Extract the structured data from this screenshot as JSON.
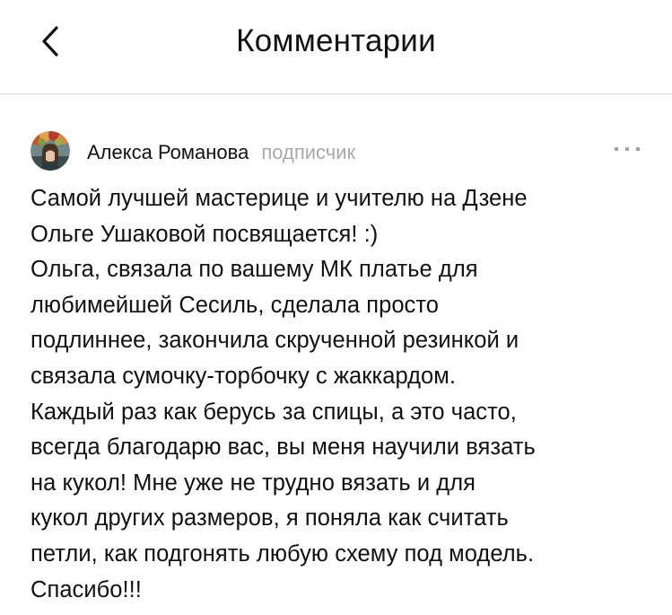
{
  "header": {
    "title": "Комментарии",
    "back_icon": "chevron-left-icon"
  },
  "comment": {
    "author": "Алекса Романова",
    "badge": "подписчик",
    "avatar_icon": "user-avatar",
    "more_icon": "more-dots-icon",
    "text": "Самой лучшей мастерице и учителю на Дзене\nОльге Ушаковой посвящается! :)\nОльга, связала по вашему МК платье для\nлюбимейшей Сесиль, сделала просто\nподлиннее, закончила скрученной резинкой и\nсвязала сумочку-торбочку с жаккардом.\nКаждый раз как берусь за спицы, а это часто,\nвсегда благодарю вас, вы меня научили вязать\nна кукол! Мне уже не трудно вязать и для\nкукол других размеров, я поняла как считать\nпетли, как подгонять любую схему под модель.\nСпасибо!!!"
  },
  "colors": {
    "text": "#111111",
    "muted": "#a9a9a9",
    "divider": "#dcdcdc",
    "background": "#ffffff"
  }
}
